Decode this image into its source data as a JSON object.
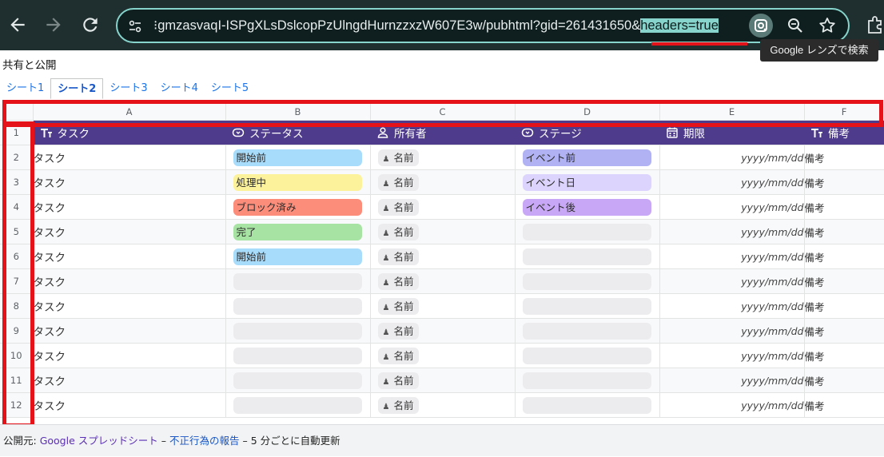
{
  "browser": {
    "url_prefix": "⁝gmzasvaqI-ISPgXLsDslcopPzUlngdHurnzzxzW607E3w/pubhtml?gid=261431650&",
    "url_highlight": "headers=true",
    "tooltip": "Google レンズで検索"
  },
  "page": {
    "title": "共有と公開",
    "tabs": [
      {
        "label": "シート1",
        "active": false
      },
      {
        "label": "シート2",
        "active": true
      },
      {
        "label": "シート3",
        "active": false
      },
      {
        "label": "シート4",
        "active": false
      },
      {
        "label": "シート5",
        "active": false
      }
    ]
  },
  "sheet": {
    "columns": [
      "A",
      "B",
      "C",
      "D",
      "E",
      "F"
    ],
    "header_row_number": "1",
    "headers": [
      {
        "label": "タスク",
        "icon": "text-type-icon"
      },
      {
        "label": "ステータス",
        "icon": "dropdown-chip-icon"
      },
      {
        "label": "所有者",
        "icon": "person-icon"
      },
      {
        "label": "ステージ",
        "icon": "dropdown-chip-icon"
      },
      {
        "label": "期限",
        "icon": "calendar-icon"
      },
      {
        "label": "備考",
        "icon": "text-type-icon"
      }
    ],
    "rows": [
      {
        "num": "2",
        "task": "タスク",
        "status": "開始前",
        "status_color": "#a8dcfb",
        "owner": "名前",
        "stage": "イベント前",
        "stage_color": "#b0b2f3",
        "date": "yyyy/mm/dd",
        "note": "備考"
      },
      {
        "num": "3",
        "task": "タスク",
        "status": "処理中",
        "status_color": "#fdf29c",
        "owner": "名前",
        "stage": "イベント日",
        "stage_color": "#dcd4fc",
        "date": "yyyy/mm/dd",
        "note": "備考"
      },
      {
        "num": "4",
        "task": "タスク",
        "status": "ブロック済み",
        "status_color": "#fc8d7a",
        "owner": "名前",
        "stage": "イベント後",
        "stage_color": "#c8a8f6",
        "date": "yyyy/mm/dd",
        "note": "備考"
      },
      {
        "num": "5",
        "task": "タスク",
        "status": "完了",
        "status_color": "#a7e3a3",
        "owner": "名前",
        "stage": "",
        "stage_color": "",
        "date": "yyyy/mm/dd",
        "note": "備考"
      },
      {
        "num": "6",
        "task": "タスク",
        "status": "開始前",
        "status_color": "#a8dcfb",
        "owner": "名前",
        "stage": "",
        "stage_color": "",
        "date": "yyyy/mm/dd",
        "note": "備考"
      },
      {
        "num": "7",
        "task": "タスク",
        "status": "",
        "status_color": "",
        "owner": "名前",
        "stage": "",
        "stage_color": "",
        "date": "yyyy/mm/dd",
        "note": "備考"
      },
      {
        "num": "8",
        "task": "タスク",
        "status": "",
        "status_color": "",
        "owner": "名前",
        "stage": "",
        "stage_color": "",
        "date": "yyyy/mm/dd",
        "note": "備考"
      },
      {
        "num": "9",
        "task": "タスク",
        "status": "",
        "status_color": "",
        "owner": "名前",
        "stage": "",
        "stage_color": "",
        "date": "yyyy/mm/dd",
        "note": "備考"
      },
      {
        "num": "10",
        "task": "タスク",
        "status": "",
        "status_color": "",
        "owner": "名前",
        "stage": "",
        "stage_color": "",
        "date": "yyyy/mm/dd",
        "note": "備考"
      },
      {
        "num": "11",
        "task": "タスク",
        "status": "",
        "status_color": "",
        "owner": "名前",
        "stage": "",
        "stage_color": "",
        "date": "yyyy/mm/dd",
        "note": "備考"
      },
      {
        "num": "12",
        "task": "タスク",
        "status": "",
        "status_color": "",
        "owner": "名前",
        "stage": "",
        "stage_color": "",
        "date": "yyyy/mm/dd",
        "note": "備考"
      }
    ]
  },
  "footer": {
    "prefix": "公開元:",
    "source_link": "Google スプレッドシート",
    "sep1": "–",
    "report_link": "不正行為の報告",
    "sep2": "–",
    "refresh_text": "5 分ごとに自動更新"
  },
  "colors": {
    "header_bg": "#4f3b8c",
    "highlight_red": "#e5121a",
    "url_highlight_bg": "#86d4cb"
  }
}
